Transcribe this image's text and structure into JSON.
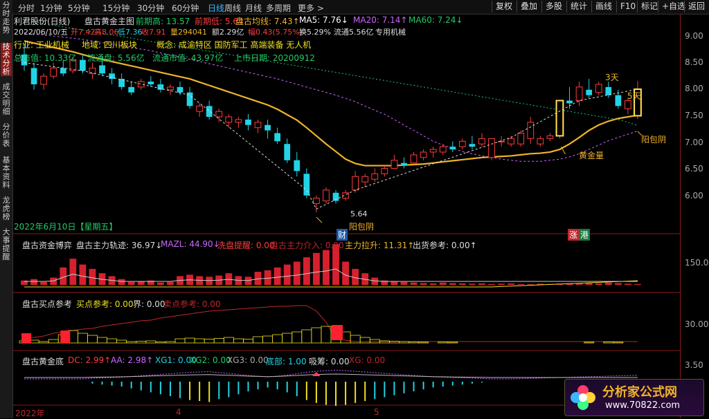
{
  "sidebar": {
    "items": [
      {
        "label": "分时走势",
        "active": false
      },
      {
        "label": "技术分析",
        "active": true
      },
      {
        "label": "成交明细",
        "active": false
      },
      {
        "label": "分价表",
        "active": false
      },
      {
        "label": "基本资料",
        "active": false
      },
      {
        "label": "龙虎榜",
        "active": false
      },
      {
        "label": "大事提醒",
        "active": false
      }
    ]
  },
  "toolbar": {
    "periods": [
      "分时",
      "1分钟",
      "5分钟",
      "15分钟",
      "30分钟",
      "60分钟",
      "日线",
      "周线",
      "月线",
      "多周期",
      "更多 >"
    ],
    "active_period": "日线",
    "buttons": [
      "复权",
      "叠加",
      "多股",
      "统计",
      "画线",
      "F10",
      "标记",
      "+自选",
      "返回"
    ]
  },
  "main_panel": {
    "stock": "利君股份(日线)",
    "indicator": "盘古黄金主图",
    "prev_high_label": "前期高: 13.57",
    "prev_low_label": "前期低: 5.64",
    "avg_label": "盘古均线: 7.43↑",
    "ma5": "MA5: 7.76↓",
    "ma20": "MA20: 7.14↑",
    "ma60": "MA60: 7.24↓",
    "quote_date": "2022/06/10/五",
    "quote_open": "开7.42",
    "quote_high": "高8.06",
    "quote_low": "低7.36",
    "quote_close": "收7.91",
    "quote_vol": "量294041",
    "quote_amt": "额2.29亿",
    "quote_chg": "幅0.43(5.75%)",
    "quote_turn": "换5.29%",
    "quote_float": "流通5.56亿",
    "quote_tag": "专用机械",
    "info_industry": "行业: 工业机械",
    "info_region": "地域: 四川板块",
    "info_concept": "概念: 成渝特区 国防军工 高端装备 无人机",
    "info_cap": "总市值: 10.33亿",
    "info_float_shares": "流通盘: 5.56亿",
    "info_float_cap": "流通市值: 43.97亿",
    "info_listing": "上市日期: 20200912",
    "ann_3day": "3天",
    "ann_5day": "5天",
    "ann_gold_vol": "黄金量",
    "ann_yang1": "阳包阴",
    "ann_yang2": "阳包阴",
    "ann_low": "5.64",
    "ann_date": "2022年6月10日【星期五】",
    "tag_cai": "财",
    "tag_zhang": "涨",
    "tag_gang": "港"
  },
  "panel2": {
    "title": "盘古资金博弈",
    "v1": "盘古主力轨迹: 36.97↓",
    "v2": "MAZL: 44.90↓",
    "v3": "洗盘提醒: 0.00",
    "v4": "盘古主力介入: 0.00",
    "v5": "主力拉升: 11.31↑",
    "v6": "出货参考: 0.00↑"
  },
  "panel3": {
    "title": "盘古买点参考",
    "v1": "买点参考: 0.00",
    "v2": "界: 0.00",
    "v3": "卖点参考: 0.00"
  },
  "panel4": {
    "title": "盘古黄金底",
    "v1": "DC: 2.99↑",
    "v2": "AA: 2.98↑",
    "v3": "XG1: 0.00",
    "v4": "XG2: 0.00",
    "v5": "XG3: 0.00",
    "v6": "底部: 1.00",
    "v7": "吸筹: 0.00",
    "v8": "XG: 0.00"
  },
  "xaxis": {
    "labels": [
      "2022年",
      "4",
      "5"
    ]
  },
  "yaxis": {
    "main": [
      "9.00",
      "8.50",
      "8.00",
      "7.50",
      "7.00",
      "6.50",
      "6.00"
    ],
    "p2": "150.0",
    "p3": "30.00",
    "p4": "3.50"
  },
  "colors": {
    "up": "#ff3c3c",
    "down": "#22d3e6",
    "gold": "#f0b429",
    "avg": "#ffffff",
    "ma": "#cc66ff",
    "ma60": "#22cc66",
    "axis_border": "#8b1a1a"
  },
  "watermark": {
    "text": "分析家公式网",
    "url": "www.70822.com"
  },
  "chart_data": {
    "type": "candlestick",
    "ylim": [
      5.5,
      9.3
    ],
    "candles": [
      {
        "o": 8.55,
        "h": 8.75,
        "l": 8.25,
        "c": 8.35
      },
      {
        "o": 8.3,
        "h": 8.4,
        "l": 7.9,
        "c": 8.0
      },
      {
        "o": 8.0,
        "h": 8.2,
        "l": 7.9,
        "c": 8.15
      },
      {
        "o": 8.15,
        "h": 8.4,
        "l": 8.1,
        "c": 8.3
      },
      {
        "o": 8.3,
        "h": 8.45,
        "l": 8.15,
        "c": 8.2
      },
      {
        "o": 8.25,
        "h": 8.5,
        "l": 8.2,
        "c": 8.45
      },
      {
        "o": 8.45,
        "h": 8.55,
        "l": 8.2,
        "c": 8.25
      },
      {
        "o": 8.2,
        "h": 8.4,
        "l": 8.1,
        "c": 8.3
      },
      {
        "o": 8.35,
        "h": 8.5,
        "l": 8.15,
        "c": 8.2
      },
      {
        "o": 8.2,
        "h": 8.3,
        "l": 8.0,
        "c": 8.1
      },
      {
        "o": 8.1,
        "h": 8.2,
        "l": 7.9,
        "c": 7.95
      },
      {
        "o": 7.95,
        "h": 8.05,
        "l": 7.8,
        "c": 7.85
      },
      {
        "o": 7.95,
        "h": 8.1,
        "l": 7.9,
        "c": 8.05
      },
      {
        "o": 8.05,
        "h": 8.15,
        "l": 7.95,
        "c": 8.0
      },
      {
        "o": 8.0,
        "h": 8.1,
        "l": 7.85,
        "c": 7.9
      },
      {
        "o": 7.9,
        "h": 8.0,
        "l": 7.8,
        "c": 7.95
      },
      {
        "o": 7.95,
        "h": 8.05,
        "l": 7.8,
        "c": 7.85
      },
      {
        "o": 7.85,
        "h": 7.95,
        "l": 7.55,
        "c": 7.6
      },
      {
        "o": 7.5,
        "h": 7.65,
        "l": 7.4,
        "c": 7.6
      },
      {
        "o": 7.6,
        "h": 7.7,
        "l": 7.35,
        "c": 7.4
      },
      {
        "o": 7.4,
        "h": 7.55,
        "l": 7.3,
        "c": 7.5
      },
      {
        "o": 7.3,
        "h": 7.45,
        "l": 7.2,
        "c": 7.4
      },
      {
        "o": 7.3,
        "h": 7.4,
        "l": 7.2,
        "c": 7.35
      },
      {
        "o": 7.35,
        "h": 7.45,
        "l": 7.15,
        "c": 7.25
      },
      {
        "o": 7.2,
        "h": 7.35,
        "l": 7.1,
        "c": 7.3
      },
      {
        "o": 7.25,
        "h": 7.35,
        "l": 7.0,
        "c": 7.15
      },
      {
        "o": 7.1,
        "h": 7.2,
        "l": 6.9,
        "c": 6.95
      },
      {
        "o": 6.9,
        "h": 7.0,
        "l": 6.55,
        "c": 6.6
      },
      {
        "o": 6.6,
        "h": 6.75,
        "l": 6.3,
        "c": 6.4
      },
      {
        "o": 6.35,
        "h": 6.45,
        "l": 5.9,
        "c": 5.95
      },
      {
        "o": 5.8,
        "h": 5.95,
        "l": 5.64,
        "c": 5.9
      },
      {
        "o": 5.85,
        "h": 6.1,
        "l": 5.8,
        "c": 6.05
      },
      {
        "o": 6.0,
        "h": 6.05,
        "l": 5.8,
        "c": 5.85
      },
      {
        "o": 5.9,
        "h": 6.05,
        "l": 5.85,
        "c": 6.0
      },
      {
        "o": 6.05,
        "h": 6.4,
        "l": 6.0,
        "c": 6.3
      },
      {
        "o": 6.2,
        "h": 6.35,
        "l": 6.1,
        "c": 6.3
      },
      {
        "o": 6.25,
        "h": 6.45,
        "l": 6.2,
        "c": 6.35
      },
      {
        "o": 6.35,
        "h": 6.5,
        "l": 6.3,
        "c": 6.45
      },
      {
        "o": 6.45,
        "h": 6.7,
        "l": 6.45,
        "c": 6.6
      },
      {
        "o": 6.55,
        "h": 6.65,
        "l": 6.45,
        "c": 6.5
      },
      {
        "o": 6.55,
        "h": 6.75,
        "l": 6.5,
        "c": 6.7
      },
      {
        "o": 6.65,
        "h": 6.8,
        "l": 6.6,
        "c": 6.75
      },
      {
        "o": 6.75,
        "h": 6.85,
        "l": 6.65,
        "c": 6.8
      },
      {
        "o": 6.75,
        "h": 6.9,
        "l": 6.7,
        "c": 6.85
      },
      {
        "o": 6.85,
        "h": 6.95,
        "l": 6.75,
        "c": 6.8
      },
      {
        "o": 6.85,
        "h": 7.0,
        "l": 6.8,
        "c": 6.95
      },
      {
        "o": 6.9,
        "h": 7.05,
        "l": 6.8,
        "c": 6.85
      },
      {
        "o": 6.9,
        "h": 7.1,
        "l": 6.85,
        "c": 7.0
      },
      {
        "o": 6.65,
        "h": 7.0,
        "l": 6.6,
        "c": 7.0
      },
      {
        "o": 6.95,
        "h": 7.05,
        "l": 6.85,
        "c": 6.95
      },
      {
        "o": 6.9,
        "h": 7.05,
        "l": 6.85,
        "c": 7.0
      },
      {
        "o": 6.9,
        "h": 7.15,
        "l": 6.85,
        "c": 7.1
      },
      {
        "o": 7.0,
        "h": 7.4,
        "l": 6.9,
        "c": 7.3
      },
      {
        "o": 6.9,
        "h": 7.05,
        "l": 6.85,
        "c": 7.0
      },
      {
        "o": 7.0,
        "h": 7.1,
        "l": 6.95,
        "c": 7.05
      },
      {
        "o": 7.05,
        "h": 7.7,
        "l": 7.0,
        "c": 7.7
      },
      {
        "o": 7.7,
        "h": 7.95,
        "l": 7.55,
        "c": 7.65
      },
      {
        "o": 7.7,
        "h": 8.05,
        "l": 7.6,
        "c": 7.95
      },
      {
        "o": 7.9,
        "h": 8.1,
        "l": 7.75,
        "c": 7.8
      },
      {
        "o": 7.85,
        "h": 8.05,
        "l": 7.8,
        "c": 8.0
      },
      {
        "o": 7.95,
        "h": 8.05,
        "l": 7.75,
        "c": 7.8
      },
      {
        "o": 7.8,
        "h": 7.9,
        "l": 7.55,
        "c": 7.6
      },
      {
        "o": 7.55,
        "h": 7.75,
        "l": 7.45,
        "c": 7.7
      },
      {
        "o": 7.42,
        "h": 8.06,
        "l": 7.36,
        "c": 7.91
      }
    ],
    "gold_line": [
      8.8,
      8.76,
      8.72,
      8.68,
      8.64,
      8.6,
      8.55,
      8.5,
      8.46,
      8.42,
      8.38,
      8.34,
      8.3,
      8.26,
      8.22,
      8.18,
      8.14,
      8.1,
      8.04,
      7.98,
      7.92,
      7.86,
      7.8,
      7.74,
      7.68,
      7.62,
      7.54,
      7.44,
      7.34,
      7.2,
      7.05,
      6.9,
      6.76,
      6.62,
      6.54,
      6.5,
      6.5,
      6.5,
      6.5,
      6.51,
      6.52,
      6.53,
      6.55,
      6.57,
      6.59,
      6.61,
      6.63,
      6.65,
      6.66,
      6.67,
      6.68,
      6.7,
      6.72,
      6.73,
      6.75,
      6.8,
      6.9,
      7.02,
      7.15,
      7.25,
      7.32,
      7.37,
      7.4,
      7.43
    ],
    "ma_purple": [
      8.95,
      8.93,
      8.91,
      8.89,
      8.87,
      8.85,
      8.83,
      8.8,
      8.77,
      8.74,
      8.71,
      8.68,
      8.65,
      8.62,
      8.58,
      8.54,
      8.5,
      8.46,
      8.42,
      8.38,
      8.34,
      8.3,
      8.26,
      8.22,
      8.18,
      8.14,
      8.1,
      8.05,
      8.0,
      7.95,
      7.9,
      7.85,
      7.8,
      7.74,
      7.68,
      7.6,
      7.52,
      7.45,
      7.35,
      7.25,
      7.15,
      7.05,
      6.95,
      6.88,
      6.82,
      6.76,
      6.72,
      6.68,
      6.65,
      6.62,
      6.6,
      6.58,
      6.58,
      6.58,
      6.6,
      6.62,
      6.66,
      6.72,
      6.8,
      6.88,
      6.96,
      7.02,
      7.08,
      7.14
    ],
    "ma_green": [
      9.18,
      9.15,
      9.12,
      9.09,
      9.06,
      9.03,
      9.0,
      8.97,
      8.94,
      8.91,
      8.88,
      8.85,
      8.82,
      8.79,
      8.76,
      8.73,
      8.7,
      8.67,
      8.64,
      8.61,
      8.58,
      8.55,
      8.52,
      8.49,
      8.46,
      8.43,
      8.4,
      8.37,
      8.34,
      8.31,
      8.28,
      8.25,
      8.22,
      8.19,
      8.16,
      8.13,
      8.1,
      8.07,
      8.04,
      8.01,
      7.98,
      7.95,
      7.92,
      7.89,
      7.86,
      7.83,
      7.8,
      7.77,
      7.74,
      7.71,
      7.68,
      7.65,
      7.62,
      7.59,
      7.56,
      7.53,
      7.5,
      7.47,
      7.44,
      7.41,
      7.38,
      7.35,
      7.3,
      7.24
    ],
    "p2_bars": [
      15,
      20,
      10,
      25,
      60,
      90,
      70,
      55,
      40,
      30,
      20,
      10,
      12,
      15,
      8,
      10,
      30,
      35,
      30,
      28,
      32,
      40,
      30,
      28,
      45,
      50,
      60,
      70,
      80,
      95,
      110,
      120,
      140,
      80,
      55,
      40,
      25,
      15,
      12,
      10,
      8,
      6,
      5,
      8,
      6,
      5,
      4,
      5,
      3,
      4,
      5,
      3,
      2,
      4,
      3,
      3,
      5,
      4,
      6,
      5,
      8,
      6,
      4,
      3
    ],
    "p4_bars": [
      0,
      0,
      0,
      0,
      0,
      0,
      0,
      -0.2,
      -0.3,
      -0.4,
      -0.5,
      -0.7,
      -0.9,
      -1.1,
      -1.3,
      -1.5,
      -1.7,
      -1.9,
      -2.0,
      -2.1,
      -1.8,
      -1.6,
      -1.3,
      -1.0,
      -0.8,
      -0.6,
      -0.8,
      -1.1,
      -1.5,
      -1.9,
      -2.2,
      -2.4,
      -2.5,
      -2.4,
      -2.2,
      -2.0,
      -1.8,
      -1.6,
      -1.4,
      -1.2,
      -1.0,
      -0.8,
      -0.6,
      -0.5,
      -0.4,
      -0.3,
      -0.2,
      -0.1,
      0,
      0,
      0,
      0,
      0,
      0,
      0,
      0,
      0,
      0,
      0,
      0,
      0,
      0,
      0,
      0
    ]
  }
}
